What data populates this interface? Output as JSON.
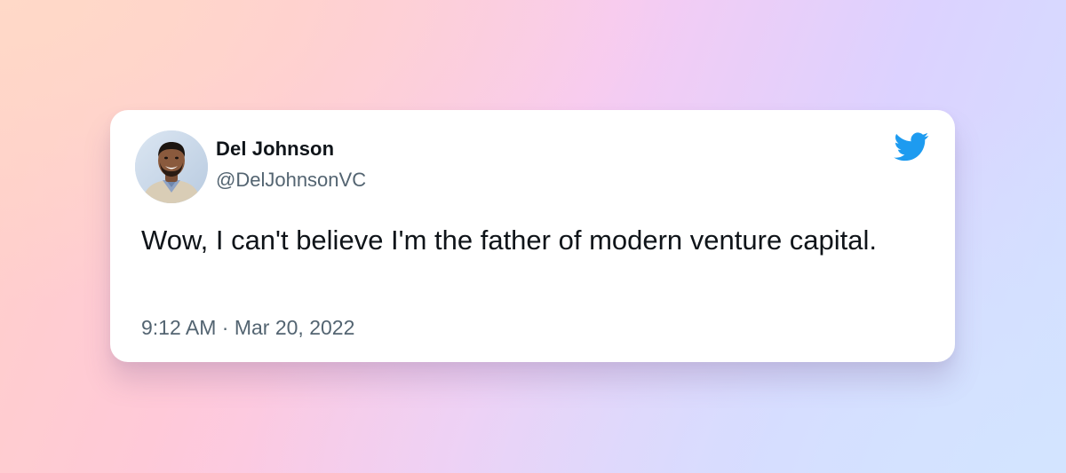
{
  "tweet": {
    "author_name": "Del Johnson",
    "author_handle": "@DelJohnsonVC",
    "text": "Wow, I can't believe I'm the father of modern venture capital.",
    "time": "9:12 AM",
    "separator": "·",
    "date": "Mar 20, 2022",
    "brand_icon": "twitter-bird-icon",
    "brand_color": "#1d9bf0"
  },
  "colors": {
    "card_background": "#ffffff",
    "text_primary": "#0f1419",
    "text_secondary": "#536471"
  }
}
